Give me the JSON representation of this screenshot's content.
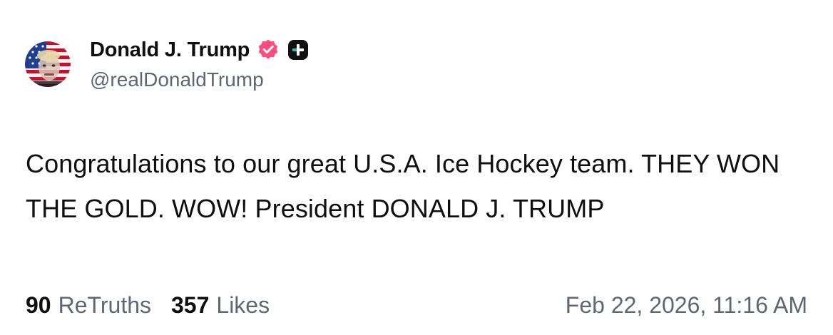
{
  "author": {
    "display_name": "Donald J. Trump",
    "handle": "@realDonaldTrump",
    "verified_icon": "verified-badge-icon",
    "plus_icon": "plus-icon"
  },
  "post": {
    "text": "Congratulations to our great U.S.A. Ice Hockey team. THEY WON THE GOLD. WOW! President DONALD J. TRUMP"
  },
  "stats": {
    "retruths_count": "90",
    "retruths_label": "ReTruths",
    "likes_count": "357",
    "likes_label": "Likes"
  },
  "timestamp": "Feb 22, 2026, 11:16 AM",
  "colors": {
    "text": "#0f0f10",
    "secondary_text": "#5f6673",
    "verified_badge": "#ff4b7d",
    "plus_badge": "#111111",
    "background": "#ffffff"
  }
}
